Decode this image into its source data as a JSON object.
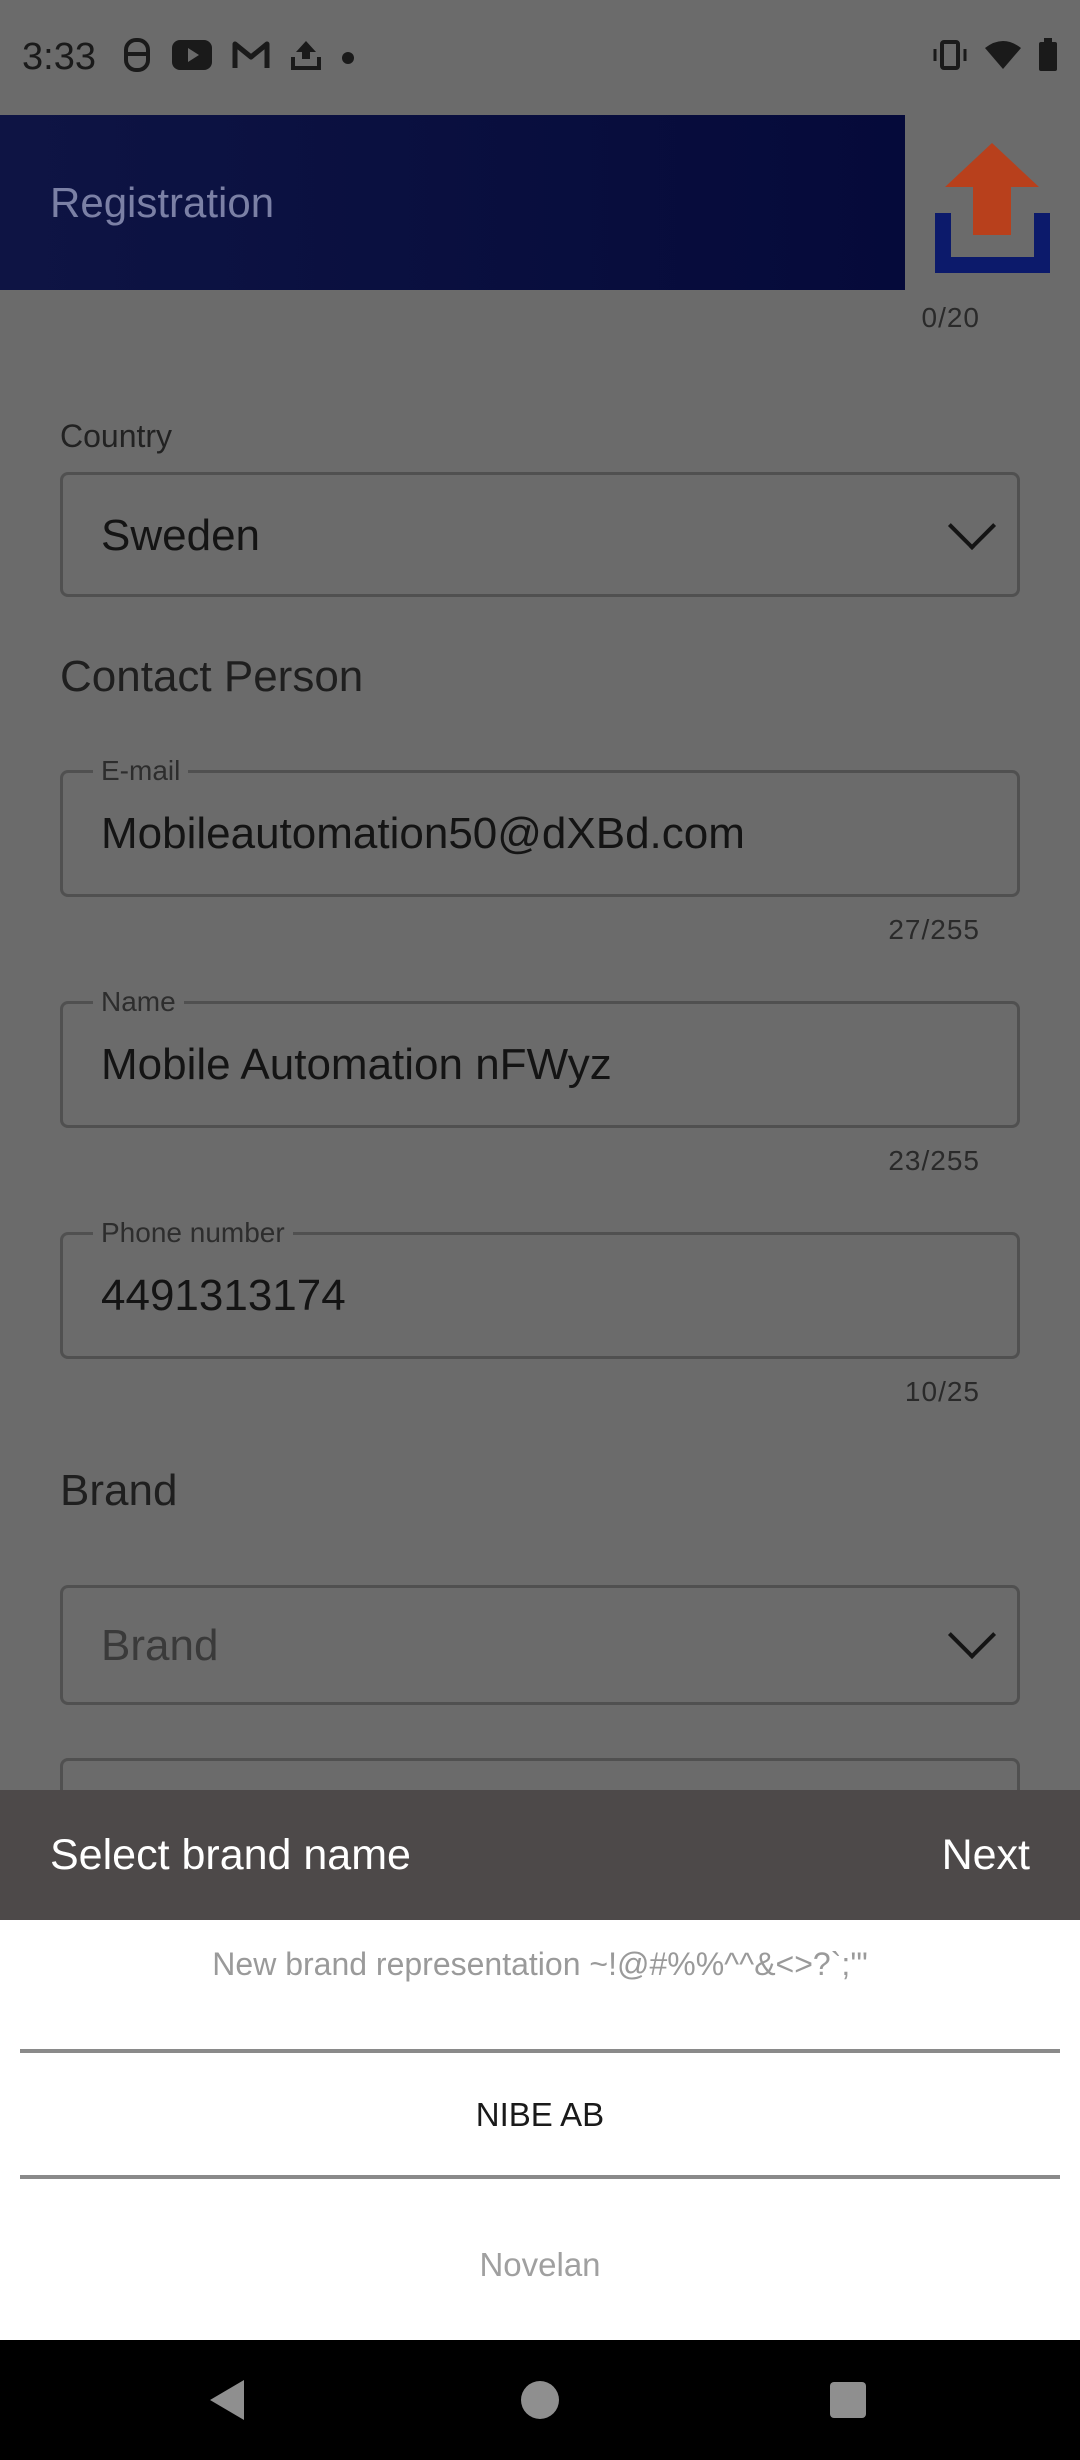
{
  "status_bar": {
    "time": "3:33",
    "left_icons": [
      "accessibility-icon",
      "youtube-icon",
      "gmail-icon",
      "upload-icon",
      "dot-icon"
    ],
    "right_icons": [
      "vibrate-icon",
      "wifi-icon",
      "battery-icon"
    ]
  },
  "app_bar": {
    "title": "Registration",
    "logo": "upload-logo-icon"
  },
  "form": {
    "top_counter": "0/20",
    "country_label": "Country",
    "country_value": "Sweden",
    "contact_section_title": "Contact Person",
    "email_label": "E-mail",
    "email_value": "Mobileautomation50@dXBd.com",
    "email_counter": "27/255",
    "name_label": "Name",
    "name_value": "Mobile Automation nFWyz",
    "name_counter": "23/255",
    "phone_label": "Phone number",
    "phone_value": "4491313174",
    "phone_counter": "10/25",
    "brand_section_title": "Brand",
    "brand_placeholder": "Brand"
  },
  "picker": {
    "title": "Select brand name",
    "next_label": "Next",
    "options": [
      "New brand representation ~!@#%%^^&<>?`;'\"",
      "NIBE AB",
      "Novelan"
    ],
    "selected_index": 1
  },
  "colors": {
    "app_bar": "#0e1444",
    "picker_header": "#4d4949",
    "logo_arrow": "#d2451e",
    "logo_tray": "#1d2f9a"
  }
}
